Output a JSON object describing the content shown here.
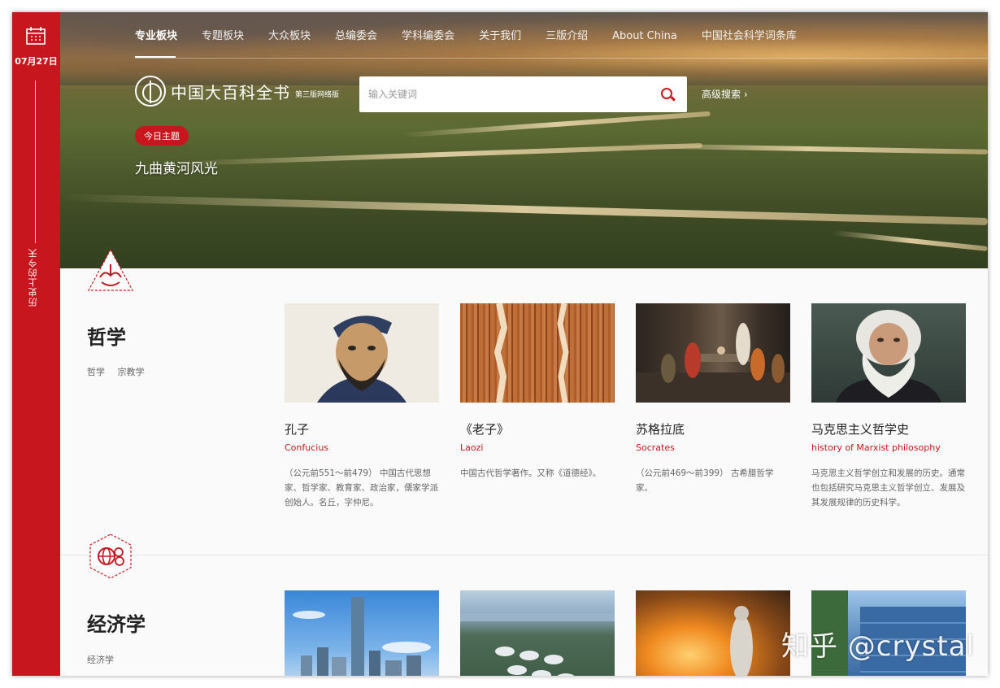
{
  "rail": {
    "date": "07月27日",
    "vertical_text": "历史上的今天"
  },
  "nav": {
    "items": [
      "专业板块",
      "专题板块",
      "大众板块",
      "总编委会",
      "学科编委会",
      "关于我们",
      "三版介绍",
      "About China",
      "中国社会科学词条库"
    ]
  },
  "logo": {
    "name": "中国大百科全书",
    "sub": "第三版网络版"
  },
  "search": {
    "placeholder": "输入关键词",
    "advanced": "高级搜索 ›"
  },
  "topic": {
    "badge": "今日主题",
    "title": "九曲黄河风光"
  },
  "sections": [
    {
      "title": "哲学",
      "tags": [
        "哲学",
        "宗教学"
      ],
      "cards": [
        {
          "title": "孔子",
          "en": "Confucius",
          "desc": "（公元前551～前479） 中国古代思想家、哲学家、教育家、政治家，儒家学派创始人。名丘，字仲尼。"
        },
        {
          "title": "《老子》",
          "en": "Laozi",
          "desc": "中国古代哲学著作。又称《道德经》。"
        },
        {
          "title": "苏格拉底",
          "en": "Socrates",
          "desc": "（公元前469～前399） 古希腊哲学家。"
        },
        {
          "title": "马克思主义哲学史",
          "en": "history of Marxist philosophy",
          "desc": "马克思主义哲学创立和发展的历史。通常也包括研究马克思主义哲学创立、发展及其发展规律的历史科学。"
        }
      ]
    },
    {
      "title": "经济学",
      "tags": [
        "经济学"
      ]
    }
  ],
  "watermark": "知乎 @crystal",
  "colors": {
    "accent": "#c8161e"
  }
}
